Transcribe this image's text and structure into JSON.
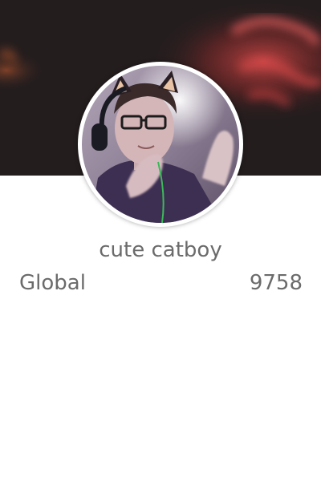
{
  "profile": {
    "username": "cute catboy",
    "stat_label": "Global",
    "stat_value": "9758"
  },
  "colors": {
    "text": "#6b6b6b",
    "banner_background": "#221c1d",
    "neon_glow": "#c23a3a",
    "avatar_border": "#ffffff"
  },
  "icons": {
    "banner": "neon-sign-banner-image",
    "avatar": "user-avatar-photo"
  }
}
